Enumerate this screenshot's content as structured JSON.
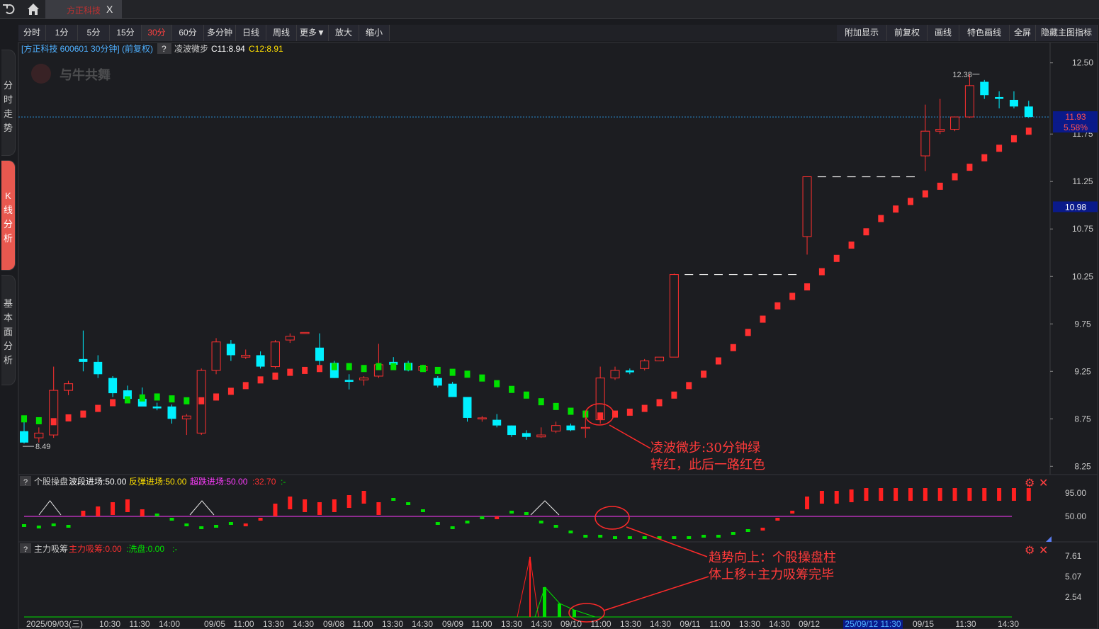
{
  "topbar": {
    "back_icon": "undo-icon",
    "home_icon": "home-icon",
    "tab_title": "方正科技",
    "tab_close": "X"
  },
  "side_tabs": [
    {
      "label": "分时走势",
      "active": false
    },
    {
      "label": "K线分析",
      "active": true
    },
    {
      "label": "基本面分析",
      "active": false
    }
  ],
  "toolbar": {
    "left": [
      {
        "label": "分时",
        "selected": false
      },
      {
        "label": "1分",
        "selected": false
      },
      {
        "label": "5分",
        "selected": false
      },
      {
        "label": "15分",
        "selected": false
      },
      {
        "label": "30分",
        "selected": true
      },
      {
        "label": "60分",
        "selected": false
      },
      {
        "label": "多分钟",
        "selected": false
      },
      {
        "label": "日线",
        "selected": false
      },
      {
        "label": "周线",
        "selected": false
      },
      {
        "label": "更多▼",
        "selected": false
      },
      {
        "label": "放大",
        "selected": false
      },
      {
        "label": "缩小",
        "selected": false
      }
    ],
    "right": [
      {
        "label": "附加显示"
      },
      {
        "label": "前复权"
      },
      {
        "label": "画线"
      },
      {
        "label": "特色画线"
      },
      {
        "label": "全屏"
      },
      {
        "label": "隐藏主图指标"
      }
    ]
  },
  "main_panel": {
    "title": "[方正科技 600601 30分钟] (前复权)",
    "help": "?",
    "indicator_name": "凌波微步",
    "c11_label": "C11:8.94",
    "c12_label": "C12:8.91",
    "watermark": "与牛共舞",
    "current_price": "11.93",
    "current_pct": "5.58%",
    "marker_price": "10.98",
    "high_label": "12.38",
    "low_label": "8.49",
    "colors": {
      "up": "#ff3030",
      "down": "#00f0ff",
      "green": "#00e000",
      "price_tag": "#0a1a8a"
    }
  },
  "panel2": {
    "help": "?",
    "name": "个股操盘",
    "items": [
      "波段进场:50.00",
      "反弹进场:50.00",
      "超跌进场:50.00",
      ":32.70",
      ":-"
    ],
    "ticks": [
      "95.00",
      "50.00"
    ]
  },
  "panel3": {
    "help": "?",
    "name": "主力吸筹",
    "items": [
      "主力吸筹:0.00",
      ":洗盘:0.00",
      ":-"
    ],
    "ticks": [
      "7.61",
      "5.07",
      "2.54"
    ]
  },
  "x_axis": [
    "2025/09/03(三)",
    "10:30",
    "11:30",
    "14:00",
    "09/05",
    "11:00",
    "13:30",
    "14:30",
    "09/08",
    "11:00",
    "13:30",
    "14:30",
    "09/09",
    "11:00",
    "13:30",
    "14:30",
    "09/10",
    "11:00",
    "13:30",
    "14:30",
    "09/11",
    "11:00",
    "13:30",
    "14:30",
    "09/12",
    "25/09/12 11:30",
    "09/15",
    "11:30",
    "14:30"
  ],
  "annotations": {
    "a1_line1": "凌波微步:30分钟绿",
    "a1_line2": "转红，此后一路红色",
    "a2_line1": "趋势向上：个股操盘柱",
    "a2_line2": "体上移+主力吸筹完毕"
  },
  "chart_data": {
    "type": "candlestick",
    "y_ticks": [
      "12.50",
      "11.75",
      "11.25",
      "10.75",
      "10.25",
      "9.75",
      "9.25",
      "8.75",
      "8.25"
    ],
    "ylim": [
      8.2,
      12.55
    ],
    "candles": [
      {
        "o": 8.62,
        "h": 8.72,
        "l": 8.49,
        "c": 8.5
      },
      {
        "o": 8.55,
        "h": 8.66,
        "l": 8.5,
        "c": 8.6
      },
      {
        "o": 8.58,
        "h": 9.3,
        "l": 8.55,
        "c": 9.05
      },
      {
        "o": 9.05,
        "h": 9.15,
        "l": 9.0,
        "c": 9.12
      },
      {
        "o": 9.38,
        "h": 9.68,
        "l": 9.25,
        "c": 9.35
      },
      {
        "o": 9.35,
        "h": 9.42,
        "l": 9.18,
        "c": 9.22
      },
      {
        "o": 9.18,
        "h": 9.2,
        "l": 8.98,
        "c": 9.02
      },
      {
        "o": 9.05,
        "h": 9.1,
        "l": 8.93,
        "c": 8.96
      },
      {
        "o": 8.96,
        "h": 9.08,
        "l": 8.9,
        "c": 8.88
      },
      {
        "o": 8.88,
        "h": 8.92,
        "l": 8.84,
        "c": 8.86
      },
      {
        "o": 8.88,
        "h": 8.9,
        "l": 8.7,
        "c": 8.75
      },
      {
        "o": 8.75,
        "h": 8.8,
        "l": 8.58,
        "c": 8.78
      },
      {
        "o": 8.6,
        "h": 9.28,
        "l": 8.58,
        "c": 9.26
      },
      {
        "o": 9.26,
        "h": 9.6,
        "l": 9.22,
        "c": 9.56
      },
      {
        "o": 9.54,
        "h": 9.58,
        "l": 9.36,
        "c": 9.42
      },
      {
        "o": 9.4,
        "h": 9.48,
        "l": 9.38,
        "c": 9.42
      },
      {
        "o": 9.42,
        "h": 9.46,
        "l": 9.28,
        "c": 9.3
      },
      {
        "o": 9.3,
        "h": 9.58,
        "l": 9.28,
        "c": 9.56
      },
      {
        "o": 9.58,
        "h": 9.65,
        "l": 9.55,
        "c": 9.62
      },
      {
        "o": 9.66,
        "h": 9.66,
        "l": 9.66,
        "c": 9.66
      },
      {
        "o": 9.5,
        "h": 9.65,
        "l": 9.3,
        "c": 9.36
      },
      {
        "o": 9.34,
        "h": 9.36,
        "l": 9.18,
        "c": 9.18
      },
      {
        "o": 9.16,
        "h": 9.22,
        "l": 9.06,
        "c": 9.14
      },
      {
        "o": 9.16,
        "h": 9.2,
        "l": 9.1,
        "c": 9.18
      },
      {
        "o": 9.2,
        "h": 9.54,
        "l": 9.18,
        "c": 9.32
      },
      {
        "o": 9.35,
        "h": 9.4,
        "l": 9.3,
        "c": 9.32
      },
      {
        "o": 9.34,
        "h": 9.36,
        "l": 9.25,
        "c": 9.26
      },
      {
        "o": 9.26,
        "h": 9.32,
        "l": 9.25,
        "c": 9.3
      },
      {
        "o": 9.18,
        "h": 9.2,
        "l": 9.08,
        "c": 9.1
      },
      {
        "o": 9.12,
        "h": 9.14,
        "l": 8.98,
        "c": 8.98
      },
      {
        "o": 8.98,
        "h": 8.98,
        "l": 8.72,
        "c": 8.76
      },
      {
        "o": 8.76,
        "h": 8.78,
        "l": 8.72,
        "c": 8.76
      },
      {
        "o": 8.74,
        "h": 8.8,
        "l": 8.66,
        "c": 8.68
      },
      {
        "o": 8.68,
        "h": 8.68,
        "l": 8.56,
        "c": 8.58
      },
      {
        "o": 8.6,
        "h": 8.63,
        "l": 8.53,
        "c": 8.56
      },
      {
        "o": 8.56,
        "h": 8.66,
        "l": 8.55,
        "c": 8.58
      },
      {
        "o": 8.62,
        "h": 8.72,
        "l": 8.6,
        "c": 8.68
      },
      {
        "o": 8.68,
        "h": 8.7,
        "l": 8.62,
        "c": 8.63
      },
      {
        "o": 8.66,
        "h": 8.76,
        "l": 8.55,
        "c": 8.66
      },
      {
        "o": 8.74,
        "h": 9.3,
        "l": 8.7,
        "c": 9.18
      },
      {
        "o": 9.18,
        "h": 9.3,
        "l": 9.16,
        "c": 9.26
      },
      {
        "o": 9.26,
        "h": 9.28,
        "l": 9.22,
        "c": 9.24
      },
      {
        "o": 9.28,
        "h": 9.38,
        "l": 9.26,
        "c": 9.36
      },
      {
        "o": 9.36,
        "h": 9.4,
        "l": 9.36,
        "c": 9.4
      },
      {
        "o": 9.4,
        "h": 10.28,
        "l": 9.4,
        "c": 10.27
      },
      {
        "o": 10.27,
        "h": 10.27,
        "l": 10.27,
        "c": 10.27
      },
      {
        "o": 10.27,
        "h": 10.27,
        "l": 10.27,
        "c": 10.27
      },
      {
        "o": 10.27,
        "h": 10.27,
        "l": 10.27,
        "c": 10.27
      },
      {
        "o": 10.27,
        "h": 10.27,
        "l": 10.27,
        "c": 10.27
      },
      {
        "o": 10.27,
        "h": 10.27,
        "l": 10.27,
        "c": 10.27
      },
      {
        "o": 10.27,
        "h": 10.27,
        "l": 10.27,
        "c": 10.27
      },
      {
        "o": 10.27,
        "h": 10.27,
        "l": 10.27,
        "c": 10.27
      },
      {
        "o": 10.27,
        "h": 10.27,
        "l": 10.27,
        "c": 10.27
      },
      {
        "o": 10.67,
        "h": 11.3,
        "l": 10.48,
        "c": 11.3
      },
      {
        "o": 11.3,
        "h": 11.3,
        "l": 11.3,
        "c": 11.3
      },
      {
        "o": 11.3,
        "h": 11.3,
        "l": 11.3,
        "c": 11.3
      },
      {
        "o": 11.3,
        "h": 11.3,
        "l": 11.3,
        "c": 11.3
      },
      {
        "o": 11.3,
        "h": 11.3,
        "l": 11.3,
        "c": 11.3
      },
      {
        "o": 11.3,
        "h": 11.3,
        "l": 11.3,
        "c": 11.3
      },
      {
        "o": 11.3,
        "h": 11.3,
        "l": 11.3,
        "c": 11.3
      },
      {
        "o": 11.3,
        "h": 11.3,
        "l": 11.3,
        "c": 11.3
      },
      {
        "o": 11.52,
        "h": 12.06,
        "l": 11.36,
        "c": 11.78
      },
      {
        "o": 11.78,
        "h": 12.12,
        "l": 11.75,
        "c": 11.8
      },
      {
        "o": 11.8,
        "h": 11.93,
        "l": 11.78,
        "c": 11.93
      },
      {
        "o": 11.93,
        "h": 12.38,
        "l": 11.92,
        "c": 12.26
      },
      {
        "o": 12.3,
        "h": 12.32,
        "l": 12.12,
        "c": 12.16
      },
      {
        "o": 12.14,
        "h": 12.2,
        "l": 12.02,
        "c": 12.12
      },
      {
        "o": 12.11,
        "h": 12.2,
        "l": 12.02,
        "c": 12.04
      },
      {
        "o": 12.04,
        "h": 12.1,
        "l": 11.92,
        "c": 11.93
      }
    ],
    "lbwb_line": [
      8.75,
      8.73,
      8.72,
      8.76,
      8.8,
      8.86,
      8.92,
      8.95,
      8.97,
      8.98,
      8.96,
      8.94,
      8.94,
      8.98,
      9.04,
      9.1,
      9.16,
      9.2,
      9.24,
      9.26,
      9.28,
      9.3,
      9.3,
      9.28,
      9.3,
      9.3,
      9.3,
      9.28,
      9.26,
      9.24,
      9.22,
      9.18,
      9.12,
      9.06,
      9.0,
      8.93,
      8.88,
      8.83,
      8.8,
      8.78,
      8.8,
      8.82,
      8.86,
      8.92,
      9.0,
      9.1,
      9.22,
      9.36,
      9.5,
      9.66,
      9.8,
      9.94,
      10.04,
      10.14,
      10.3,
      10.44,
      10.58,
      10.72,
      10.86,
      10.96,
      11.04,
      11.12,
      11.2,
      11.3,
      11.4,
      11.5,
      11.6,
      11.7,
      11.78
    ],
    "lbwb_color": [
      "g",
      "g",
      "r",
      "r",
      "r",
      "r",
      "r",
      "g",
      "g",
      "g",
      "g",
      "g",
      "r",
      "r",
      "r",
      "r",
      "r",
      "r",
      "r",
      "r",
      "r",
      "g",
      "g",
      "g",
      "g",
      "g",
      "g",
      "g",
      "g",
      "g",
      "g",
      "g",
      "g",
      "g",
      "g",
      "g",
      "g",
      "g",
      "g",
      "r",
      "r",
      "r",
      "r",
      "r",
      "r",
      "r",
      "r",
      "r",
      "r",
      "r",
      "r",
      "r",
      "r",
      "r",
      "r",
      "r",
      "r",
      "r",
      "r",
      "r",
      "r",
      "r",
      "r",
      "r",
      "r",
      "r",
      "r",
      "r",
      "r"
    ]
  }
}
